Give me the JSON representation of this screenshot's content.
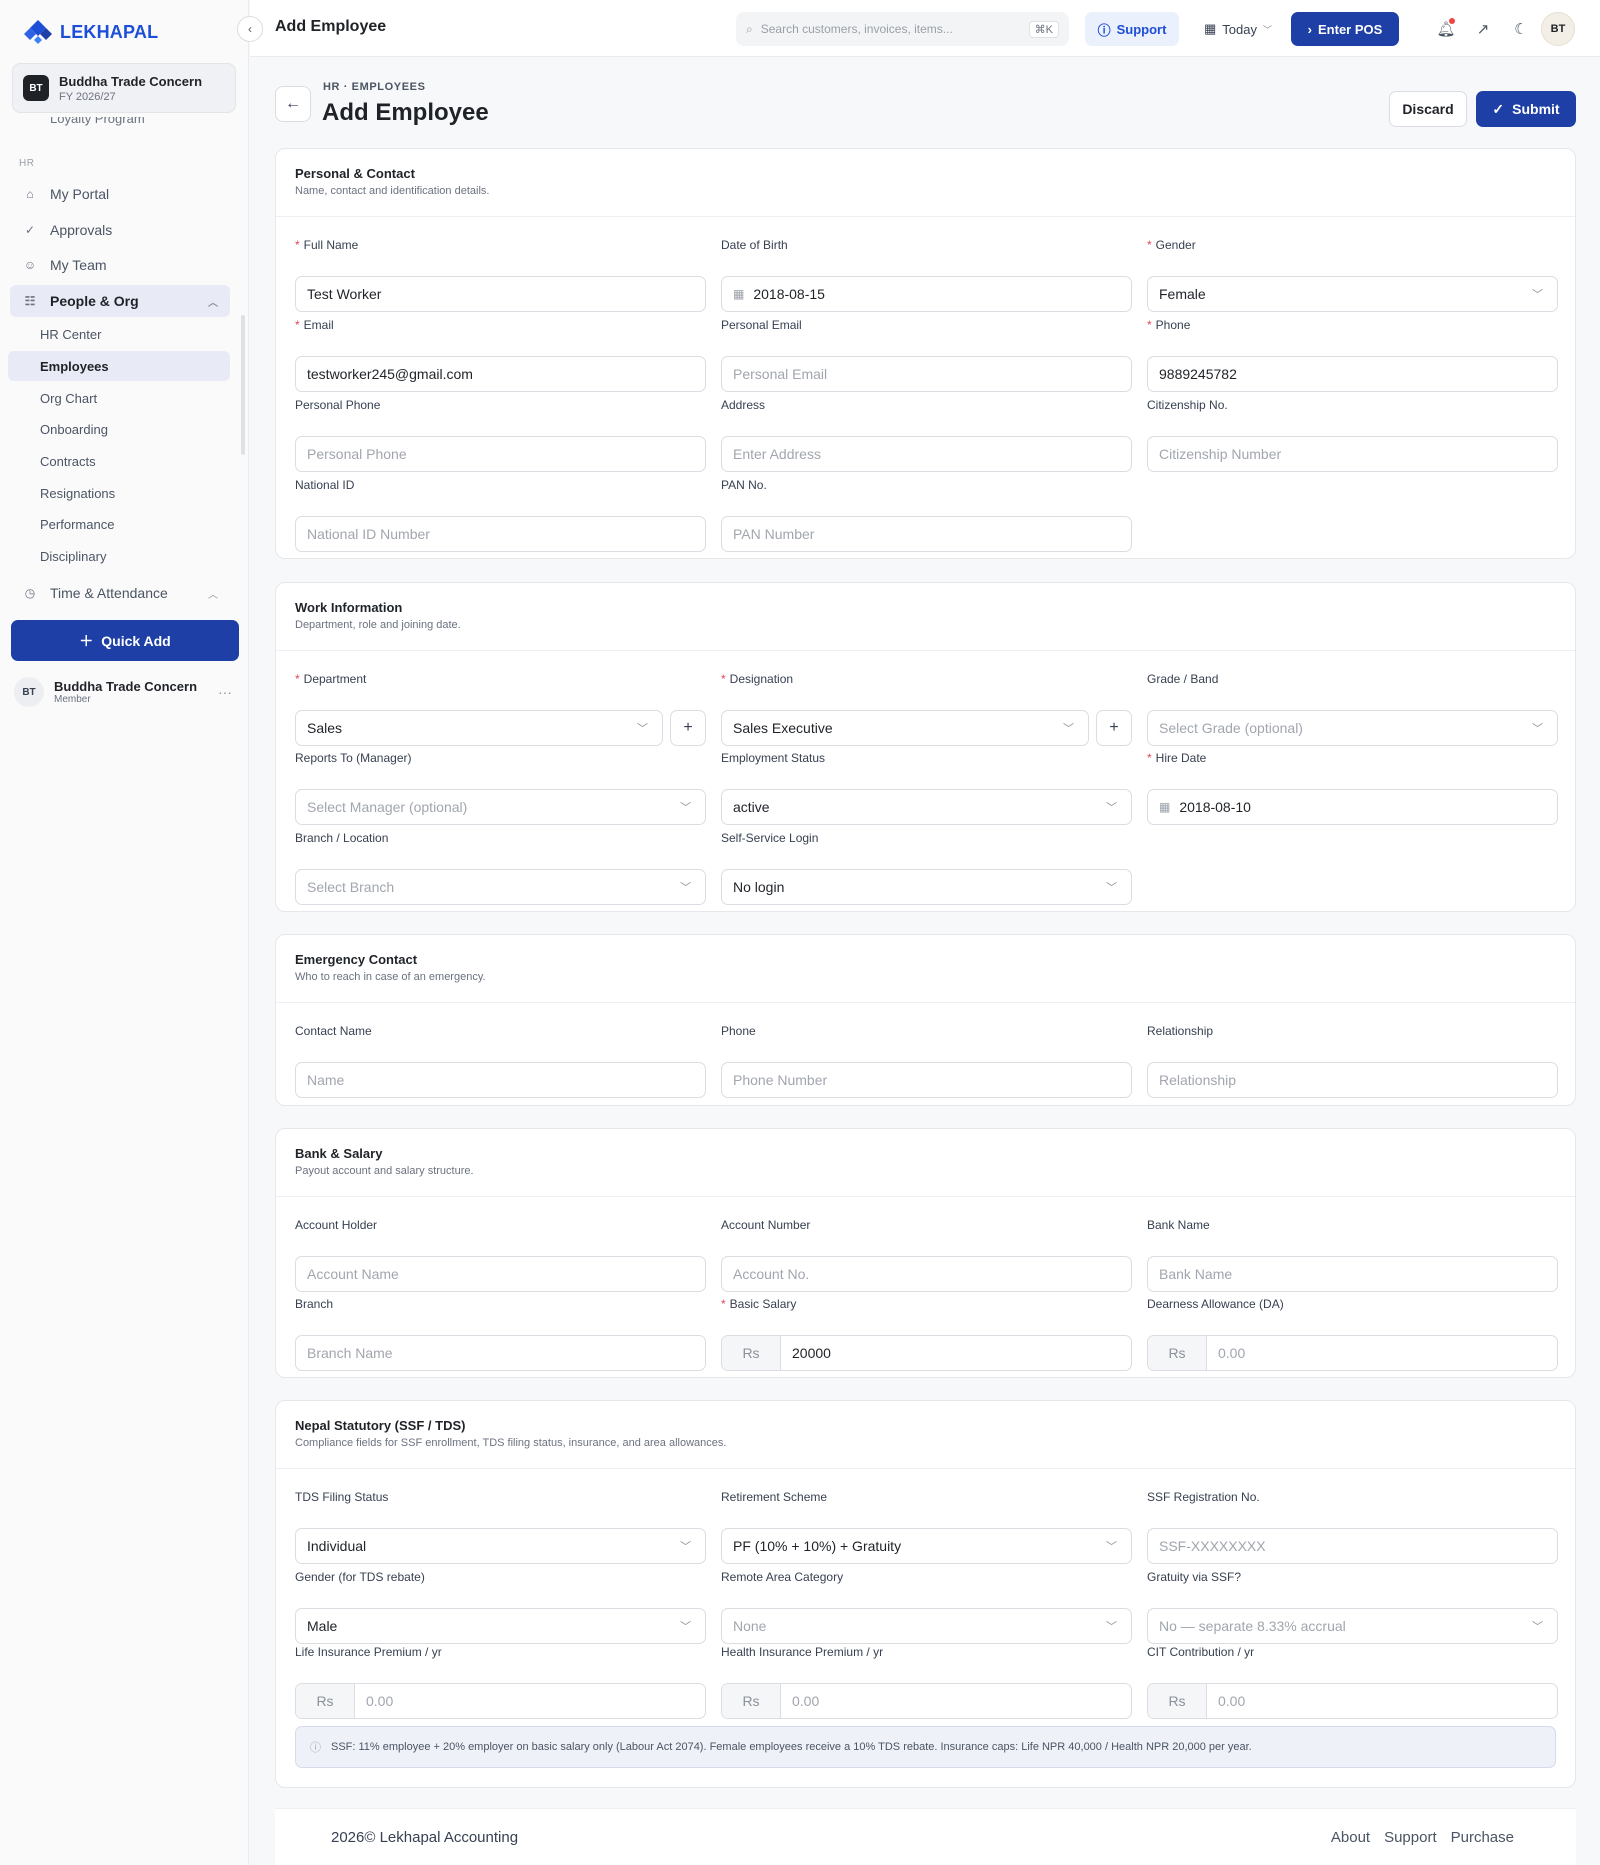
{
  "app": {
    "brand": "LEKHAPAL",
    "accent": "#1d3fa6"
  },
  "org": {
    "badge": "BT",
    "name": "Buddha Trade Concern",
    "fy": "FY 2026/27"
  },
  "sidebar": {
    "cut_item": "Loyalty Program",
    "section": "HR",
    "items": [
      {
        "label": "My Portal",
        "icon": "portal-icon"
      },
      {
        "label": "Approvals",
        "icon": "approvals-icon"
      },
      {
        "label": "My Team",
        "icon": "team-icon"
      },
      {
        "label": "People & Org",
        "icon": "people-icon"
      },
      {
        "label": "Time & Attendance",
        "icon": "clock-icon"
      }
    ],
    "sub_items": [
      "HR Center",
      "Employees",
      "Org Chart",
      "Onboarding",
      "Contracts",
      "Resignations",
      "Performance",
      "Disciplinary"
    ],
    "quick_add": "Quick Add",
    "user": {
      "badge": "BT",
      "name": "Buddha Trade Concern",
      "role": "Member"
    }
  },
  "topbar": {
    "title": "Add Employee",
    "search_placeholder": "Search customers, invoices, items...",
    "search_kbd": "⌘K",
    "support": "Support",
    "today": "Today",
    "enter_pos": "Enter POS",
    "avatar": "BT"
  },
  "page": {
    "breadcrumb": "HR · EMPLOYEES",
    "title": "Add Employee",
    "discard": "Discard",
    "submit": "Submit"
  },
  "personal": {
    "title": "Personal & Contact",
    "subtitle": "Name, contact and identification details.",
    "full_name": {
      "label": "Full Name",
      "value": "Test Worker"
    },
    "dob": {
      "label": "Date of Birth",
      "value": "2018-08-15"
    },
    "gender": {
      "label": "Gender",
      "value": "Female"
    },
    "email": {
      "label": "Email",
      "value": "testworker245@gmail.com"
    },
    "personal_email": {
      "label": "Personal Email",
      "placeholder": "Personal Email"
    },
    "phone": {
      "label": "Phone",
      "value": "9889245782"
    },
    "personal_phone": {
      "label": "Personal Phone",
      "placeholder": "Personal Phone"
    },
    "address": {
      "label": "Address",
      "placeholder": "Enter Address"
    },
    "citizenship": {
      "label": "Citizenship No.",
      "placeholder": "Citizenship Number"
    },
    "national_id": {
      "label": "National ID",
      "placeholder": "National ID Number"
    },
    "pan": {
      "label": "PAN No.",
      "placeholder": "PAN Number"
    }
  },
  "work": {
    "title": "Work Information",
    "subtitle": "Department, role and joining date.",
    "department": {
      "label": "Department",
      "value": "Sales"
    },
    "designation": {
      "label": "Designation",
      "value": "Sales Executive"
    },
    "grade": {
      "label": "Grade / Band",
      "placeholder": "Select Grade (optional)"
    },
    "reports_to": {
      "label": "Reports To (Manager)",
      "placeholder": "Select Manager (optional)"
    },
    "status": {
      "label": "Employment Status",
      "value": "active"
    },
    "hire_date": {
      "label": "Hire Date",
      "value": "2018-08-10"
    },
    "branch": {
      "label": "Branch / Location",
      "placeholder": "Select Branch"
    },
    "login": {
      "label": "Self-Service Login",
      "value": "No login"
    }
  },
  "emergency": {
    "title": "Emergency Contact",
    "subtitle": "Who to reach in case of an emergency.",
    "name": {
      "label": "Contact Name",
      "placeholder": "Name"
    },
    "phone": {
      "label": "Phone",
      "placeholder": "Phone Number"
    },
    "relationship": {
      "label": "Relationship",
      "placeholder": "Relationship"
    }
  },
  "bank": {
    "title": "Bank & Salary",
    "subtitle": "Payout account and salary structure.",
    "holder": {
      "label": "Account Holder",
      "placeholder": "Account Name"
    },
    "number": {
      "label": "Account Number",
      "placeholder": "Account No."
    },
    "bank_name": {
      "label": "Bank Name",
      "placeholder": "Bank Name"
    },
    "branch": {
      "label": "Branch",
      "placeholder": "Branch Name"
    },
    "basic": {
      "label": "Basic Salary",
      "prefix": "Rs",
      "value": "20000"
    },
    "da": {
      "label": "Dearness Allowance (DA)",
      "prefix": "Rs",
      "placeholder": "0.00"
    }
  },
  "statutory": {
    "title": "Nepal Statutory (SSF / TDS)",
    "subtitle": "Compliance fields for SSF enrollment, TDS filing status, insurance, and area allowances.",
    "tds_status": {
      "label": "TDS Filing Status",
      "value": "Individual"
    },
    "retirement": {
      "label": "Retirement Scheme",
      "value": "PF (10% + 10%) + Gratuity"
    },
    "ssf_reg": {
      "label": "SSF Registration No.",
      "placeholder": "SSF-XXXXXXXX"
    },
    "tds_gender": {
      "label": "Gender (for TDS rebate)",
      "value": "Male"
    },
    "remote": {
      "label": "Remote Area Category",
      "placeholder": "None"
    },
    "gratuity": {
      "label": "Gratuity via SSF?",
      "placeholder": "No — separate 8.33% accrual"
    },
    "life": {
      "label": "Life Insurance Premium / yr",
      "prefix": "Rs",
      "placeholder": "0.00"
    },
    "health": {
      "label": "Health Insurance Premium / yr",
      "prefix": "Rs",
      "placeholder": "0.00"
    },
    "cit": {
      "label": "CIT Contribution / yr",
      "prefix": "Rs",
      "placeholder": "0.00"
    },
    "note": "SSF: 11% employee + 20% employer on basic salary only (Labour Act 2074). Female employees receive a 10% TDS rebate. Insurance caps: Life NPR 40,000 / Health NPR 20,000 per year."
  },
  "footer": {
    "copyright": "2026© Lekhapal Accounting",
    "links": [
      "About",
      "Support",
      "Purchase"
    ]
  }
}
